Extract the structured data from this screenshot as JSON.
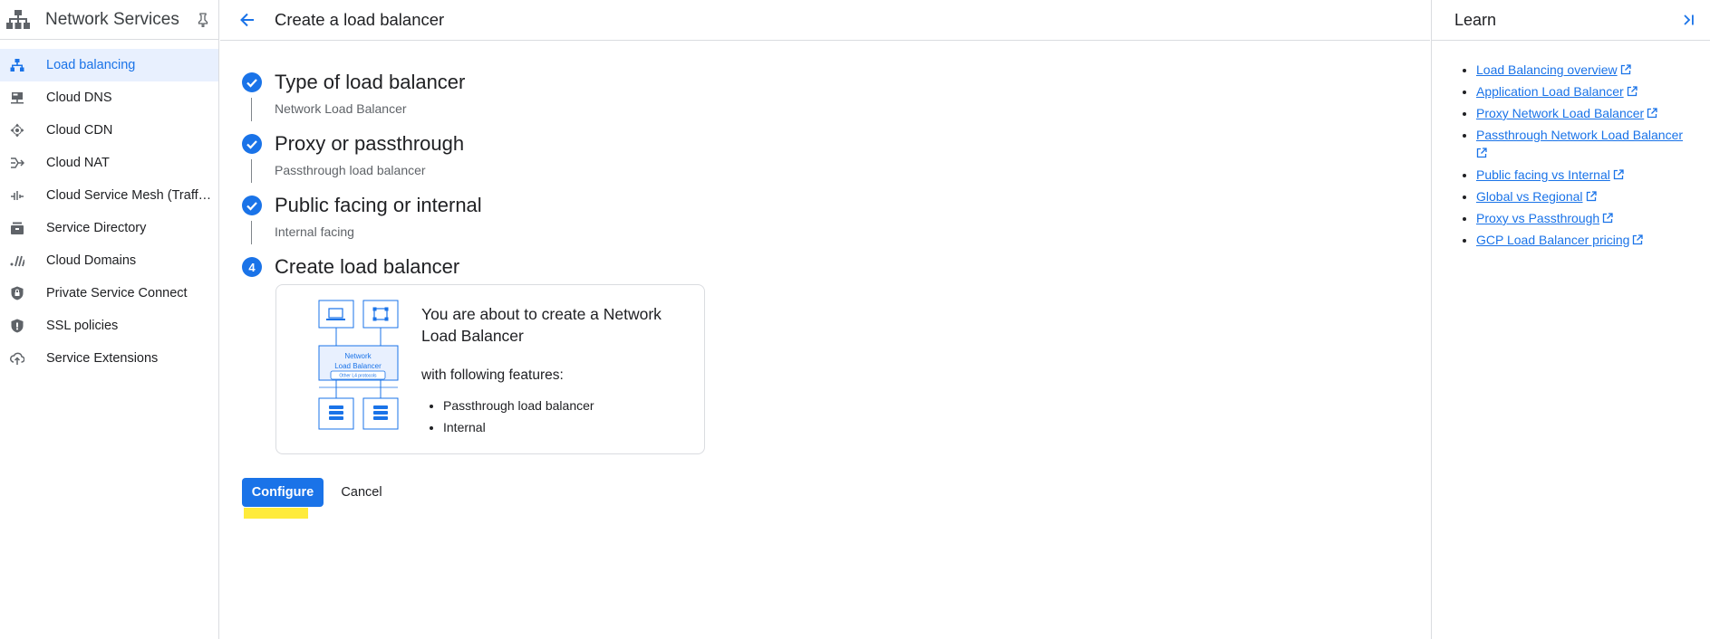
{
  "colors": {
    "accent": "#1a73e8",
    "highlight": "#ffeb3b",
    "divider": "#dadce0"
  },
  "sidebar": {
    "product_title": "Network Services",
    "items": [
      {
        "label": "Load balancing",
        "icon": "load-balancing-icon",
        "active": true
      },
      {
        "label": "Cloud DNS",
        "icon": "dns-icon",
        "active": false
      },
      {
        "label": "Cloud CDN",
        "icon": "cdn-icon",
        "active": false
      },
      {
        "label": "Cloud NAT",
        "icon": "nat-icon",
        "active": false
      },
      {
        "label": "Cloud Service Mesh (Traff…",
        "icon": "service-mesh-icon",
        "active": false
      },
      {
        "label": "Service Directory",
        "icon": "service-directory-icon",
        "active": false
      },
      {
        "label": "Cloud Domains",
        "icon": "domains-icon",
        "active": false
      },
      {
        "label": "Private Service Connect",
        "icon": "private-service-connect-icon",
        "active": false
      },
      {
        "label": "SSL policies",
        "icon": "ssl-policies-icon",
        "active": false
      },
      {
        "label": "Service Extensions",
        "icon": "service-extensions-icon",
        "active": false
      }
    ]
  },
  "header": {
    "title": "Create a load balancer"
  },
  "steps": [
    {
      "title": "Type of load balancer",
      "value": "Network Load Balancer",
      "status": "complete"
    },
    {
      "title": "Proxy or passthrough",
      "value": "Passthrough load balancer",
      "status": "complete"
    },
    {
      "title": "Public facing or internal",
      "value": "Internal facing",
      "status": "complete"
    },
    {
      "title": "Create load balancer",
      "number": "4",
      "status": "current"
    }
  ],
  "summary": {
    "heading": "You are about to create a Network Load Balancer",
    "features_label": "with following features:",
    "features": [
      "Passthrough load balancer",
      "Internal"
    ],
    "diagram": {
      "box_label": "Network Load Balancer",
      "chip_label": "Other L4 protocols"
    }
  },
  "actions": {
    "configure": "Configure",
    "cancel": "Cancel"
  },
  "learn": {
    "title": "Learn",
    "links": [
      "Load Balancing overview",
      "Application Load Balancer",
      "Proxy Network Load Balancer",
      "Passthrough Network Load Balancer",
      "Public facing vs Internal",
      "Global vs Regional",
      "Proxy vs Passthrough",
      "GCP Load Balancer pricing"
    ]
  }
}
